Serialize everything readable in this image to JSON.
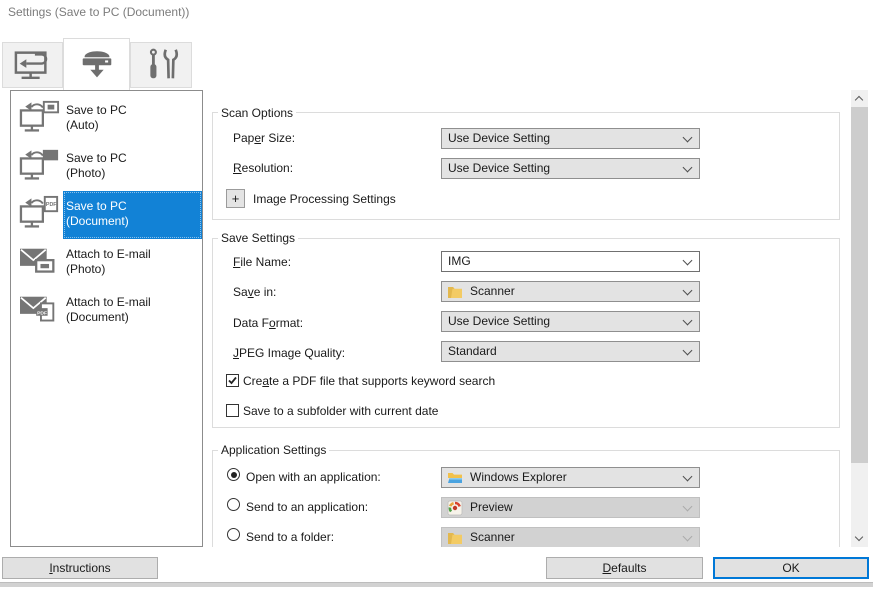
{
  "window": {
    "title": "Settings (Save to PC (Document))"
  },
  "tabs": [
    {
      "icon": "scan-computer",
      "selected": false
    },
    {
      "icon": "scanner-save",
      "selected": true
    },
    {
      "icon": "tools",
      "selected": false
    }
  ],
  "sidebar": {
    "items": [
      {
        "line1": "Save to PC",
        "line2": "(Auto)",
        "icon": "save-to-pc-auto",
        "selected": false
      },
      {
        "line1": "Save to PC",
        "line2": "(Photo)",
        "icon": "save-to-pc-photo",
        "selected": false
      },
      {
        "line1": "Save to PC",
        "line2": "(Document)",
        "icon": "save-to-pc-document",
        "selected": true
      },
      {
        "line1": "Attach to E-mail",
        "line2": "(Photo)",
        "icon": "attach-email-photo",
        "selected": false
      },
      {
        "line1": "Attach to E-mail",
        "line2": "(Document)",
        "icon": "attach-email-document",
        "selected": false
      }
    ]
  },
  "scan_options": {
    "title": "Scan Options",
    "paper_size": {
      "label_html": "Pap<u>e</u>r Size:",
      "value": "Use Device Setting"
    },
    "resolution": {
      "label_html": "<u>R</u>esolution:",
      "value": "Use Device Setting"
    },
    "image_processing": {
      "button": "+",
      "label": "Image Processing Settings"
    }
  },
  "save_settings": {
    "title": "Save Settings",
    "file_name": {
      "label_html": "<u>F</u>ile Name:",
      "value": "IMG"
    },
    "save_in": {
      "label_html": "Sa<u>v</u>e in:",
      "value": "Scanner",
      "icon": "folder"
    },
    "data_format": {
      "label_html": "Data F<u>o</u>rmat:",
      "value": "Use Device Setting"
    },
    "jpeg_quality": {
      "label_html": "<u>J</u>PEG Image Quality:",
      "value": "Standard"
    },
    "pdf_keyword": {
      "label_html": "Cre<u>a</u>te a PDF file that supports keyword search",
      "checked": true
    },
    "subfolder": {
      "label_html": "Save to a subfolder with current date",
      "checked": false
    }
  },
  "application_settings": {
    "title": "Application Settings",
    "open_with": {
      "label": "Open with an application:",
      "selected": true,
      "value": "Windows Explorer",
      "icon": "windows-explorer",
      "enabled": true
    },
    "send_app": {
      "label": "Send to an application:",
      "selected": false,
      "value": "Preview",
      "icon": "preview-app",
      "enabled": false
    },
    "send_folder": {
      "label": "Send to a folder:",
      "selected": false,
      "value": "Scanner",
      "icon": "folder",
      "enabled": false
    }
  },
  "footer": {
    "instructions_html": "<u>I</u>nstructions",
    "defaults_html": "<u>D</u>efaults",
    "ok": "OK"
  },
  "colors": {
    "selection_blue": "#1282d6",
    "focus_blue": "#0078d7",
    "icon_gray": "#757575"
  }
}
